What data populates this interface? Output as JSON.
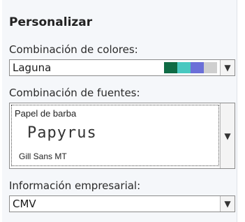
{
  "section": {
    "title": "Personalizar"
  },
  "color_scheme": {
    "label": "Combinación de colores:",
    "value": "Laguna",
    "swatches": [
      "#0f6b45",
      "#48c8c0",
      "#6b6fd8",
      "#cfcfcf"
    ],
    "arrow_icon": "chevron-down-icon"
  },
  "font_scheme": {
    "label": "Combinación de fuentes:",
    "name": "Papel de barba",
    "major_font": "Papyrus",
    "minor_font": "Gill Sans MT",
    "arrow_icon": "chevron-down-icon"
  },
  "business_info": {
    "label": "Información empresarial:",
    "value": "CMV",
    "arrow_icon": "chevron-down-icon"
  }
}
